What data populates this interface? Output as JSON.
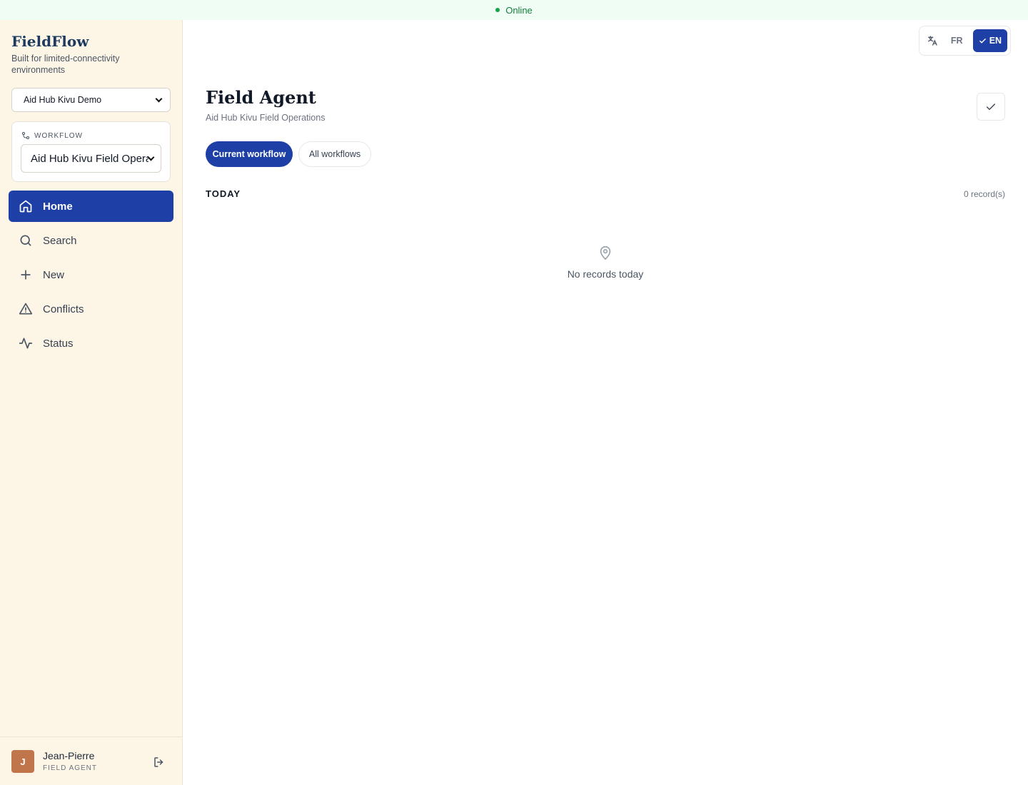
{
  "status": {
    "label": "Online",
    "color": "#16a34a"
  },
  "app": {
    "name": "FieldFlow",
    "tagline": "Built for limited-connectivity environments"
  },
  "org_select": {
    "value": "Aid Hub Kivu Demo"
  },
  "workflow": {
    "heading": "WORKFLOW",
    "value": "Aid Hub Kivu Field Operations"
  },
  "nav": {
    "items": [
      {
        "label": "Home",
        "icon": "home-icon",
        "active": true
      },
      {
        "label": "Search",
        "icon": "search-icon",
        "active": false
      },
      {
        "label": "New",
        "icon": "plus-icon",
        "active": false
      },
      {
        "label": "Conflicts",
        "icon": "warning-icon",
        "active": false
      },
      {
        "label": "Status",
        "icon": "activity-icon",
        "active": false
      }
    ]
  },
  "user": {
    "initial": "J",
    "name": "Jean-Pierre",
    "role": "FIELD AGENT"
  },
  "language": {
    "options": [
      "FR",
      "EN"
    ],
    "selected": "EN"
  },
  "page": {
    "title": "Field Agent",
    "subtitle": "Aid Hub Kivu Field Operations"
  },
  "filters": {
    "current": "Current workflow",
    "all": "All workflows",
    "selected": "Current workflow"
  },
  "today": {
    "title": "TODAY",
    "count": "0 record(s)",
    "empty": "No records today"
  },
  "colors": {
    "accent": "#1e3fa6",
    "sidebar_bg": "#fdf6e7",
    "avatar": "#c0754a"
  }
}
